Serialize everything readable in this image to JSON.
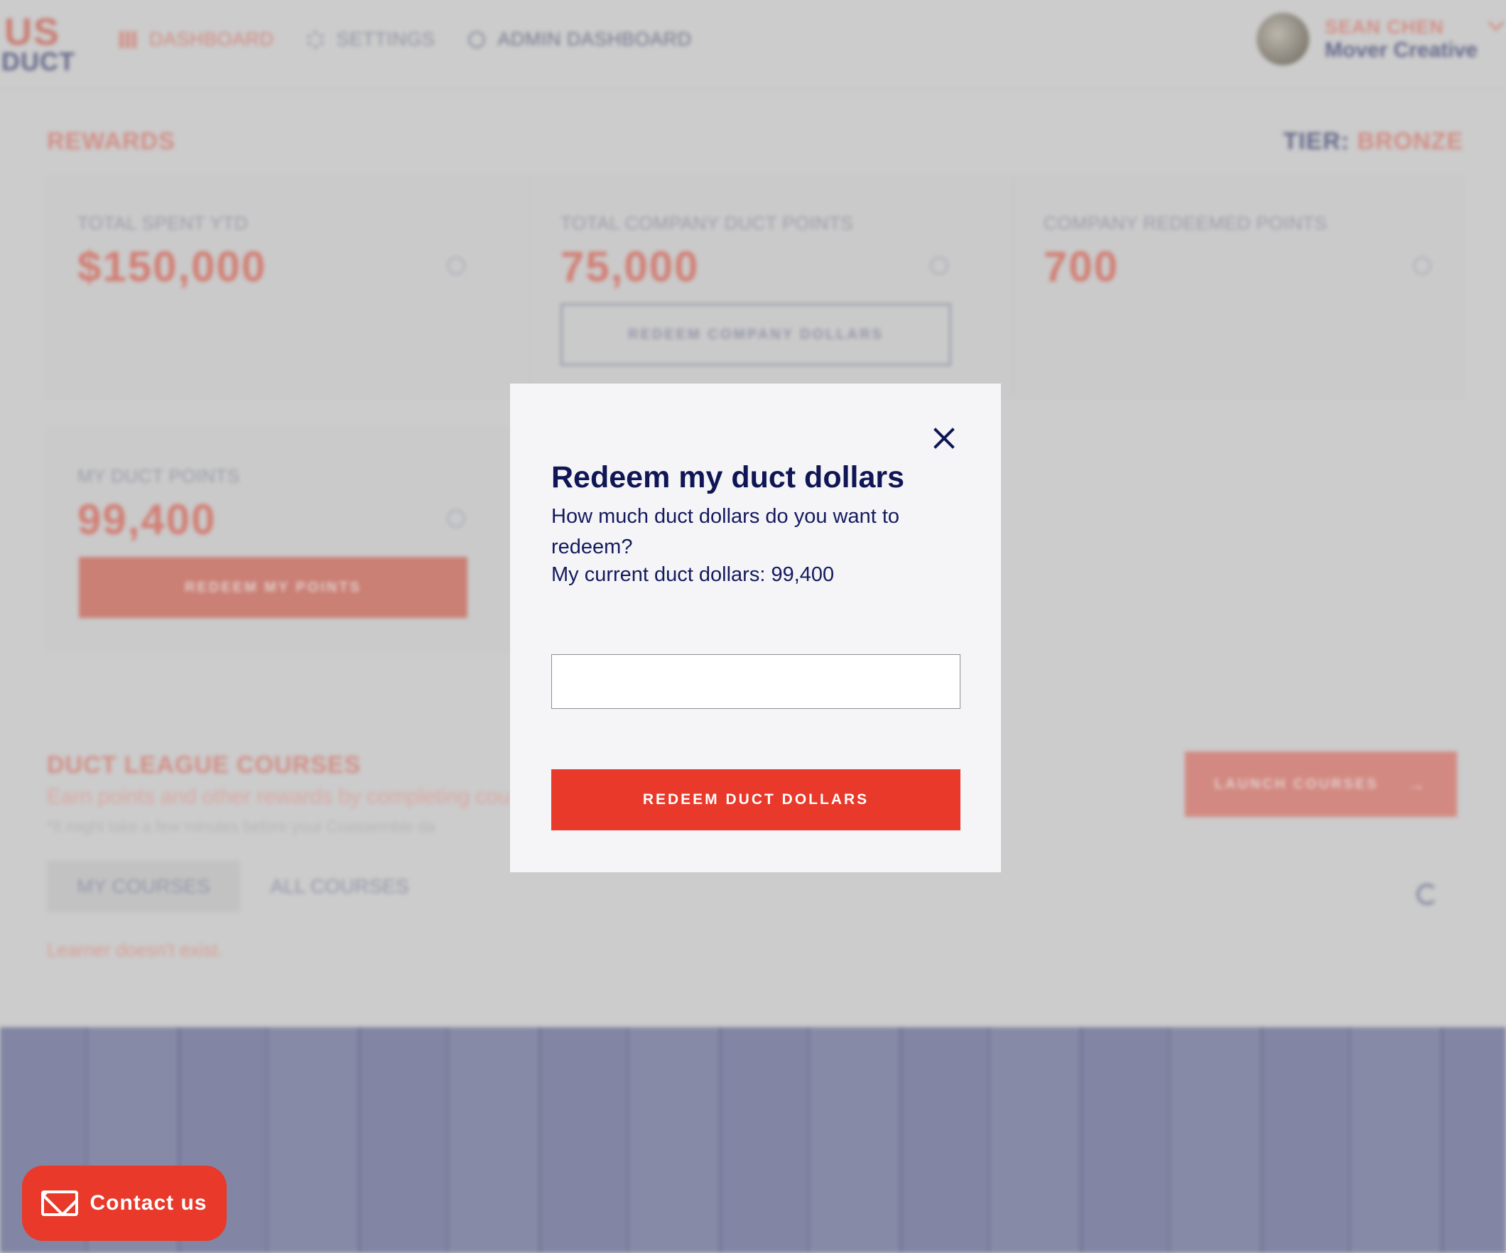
{
  "logo": {
    "line1": "US",
    "line2": "DUCT"
  },
  "nav": {
    "items": [
      {
        "label": "DASHBOARD"
      },
      {
        "label": "SETTINGS"
      },
      {
        "label": "ADMIN DASHBOARD"
      }
    ]
  },
  "user": {
    "name": "SEAN CHEN",
    "company": "Mover Creative"
  },
  "rewards": {
    "title": "REWARDS",
    "tier_label": "TIER:",
    "tier_value": "BRONZE",
    "cards": [
      {
        "label": "TOTAL SPENT YTD",
        "value": "$150,000"
      },
      {
        "label": "TOTAL COMPANY DUCT POINTS",
        "value": "75,000",
        "button": "REDEEM COMPANY DOLLARS"
      },
      {
        "label": "COMPANY REDEEMED POINTS",
        "value": "700"
      },
      {
        "label": "MY DUCT POINTS",
        "value": "99,400",
        "button": "REDEEM MY POINTS"
      }
    ]
  },
  "courses": {
    "title": "DUCT LEAGUE COURSES",
    "subtitle": "Earn points and other rewards by completing cou",
    "note": "*It might take a few minutes before your Coassemble da",
    "launch_button": "LAUNCH COURSES",
    "tabs": [
      {
        "label": "MY COURSES"
      },
      {
        "label": "ALL COURSES"
      }
    ],
    "error": "Learner doesn't exist."
  },
  "modal": {
    "title": "Redeem my duct dollars",
    "description": "How much duct dollars do you want to redeem?",
    "current_label": "My current duct dollars: 99,400",
    "input_value": "",
    "button_label": "REDEEM DUCT DOLLARS"
  },
  "contact": {
    "label": "Contact us"
  },
  "colors": {
    "accent": "#e8392a",
    "navy": "#0f1555"
  }
}
